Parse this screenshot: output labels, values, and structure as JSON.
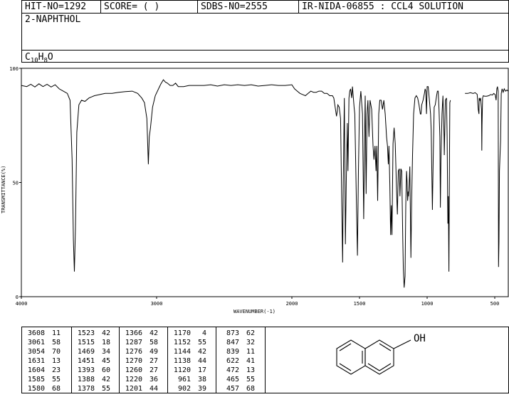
{
  "header": {
    "hit": "HIT-NO=1292",
    "score": "SCORE=  (  )",
    "sdbs": "SDBS-NO=2555",
    "ir": "IR-NIDA-06855 : CCL4 SOLUTION",
    "name": "2-NAPHTHOL",
    "formula_c": "C",
    "formula_c_sub": "10",
    "formula_h": "H",
    "formula_h_sub": "8",
    "formula_o": "O"
  },
  "chart_data": {
    "type": "line",
    "xlabel": "WAVENUMBER(-1)",
    "ylabel": "TRANSMITTANCE(%)",
    "xlim": [
      4000,
      400
    ],
    "ylim": [
      0,
      100
    ],
    "xticks": [
      4000,
      3000,
      2000,
      1500,
      1000,
      500
    ],
    "xtick_labels": [
      "4000",
      "3000",
      "2000",
      "1500",
      "1000",
      "500"
    ],
    "yticks": [
      0,
      50,
      100
    ],
    "ytick_labels": [
      "0",
      "50",
      "100"
    ],
    "grid": false,
    "series": [
      {
        "segments": [
          [
            [
              4000,
              92.5
            ],
            [
              3960,
              92
            ],
            [
              3930,
              93
            ],
            [
              3900,
              91.8
            ],
            [
              3870,
              93.2
            ],
            [
              3840,
              92
            ],
            [
              3810,
              93
            ],
            [
              3780,
              91.8
            ],
            [
              3750,
              92.8
            ],
            [
              3720,
              91
            ],
            [
              3690,
              90
            ],
            [
              3660,
              89
            ],
            [
              3640,
              86
            ],
            [
              3625,
              60
            ],
            [
              3615,
              25
            ],
            [
              3608,
              11
            ],
            [
              3600,
              30
            ],
            [
              3590,
              72
            ],
            [
              3575,
              84
            ],
            [
              3555,
              86
            ],
            [
              3530,
              85.5
            ],
            [
              3500,
              87
            ],
            [
              3460,
              88
            ],
            [
              3420,
              88.5
            ],
            [
              3380,
              89
            ],
            [
              3330,
              89
            ],
            [
              3280,
              89.5
            ],
            [
              3230,
              89.8
            ],
            [
              3180,
              90
            ],
            [
              3140,
              89
            ],
            [
              3110,
              87
            ],
            [
              3090,
              85
            ],
            [
              3072,
              78
            ],
            [
              3061,
              58
            ],
            [
              3054,
              70
            ],
            [
              3045,
              74
            ],
            [
              3030,
              83
            ],
            [
              3010,
              88
            ],
            [
              2990,
              90.5
            ],
            [
              2970,
              93
            ],
            [
              2950,
              95
            ],
            [
              2935,
              94
            ],
            [
              2920,
              93.5
            ],
            [
              2900,
              92.5
            ],
            [
              2880,
              92.5
            ],
            [
              2860,
              93.5
            ],
            [
              2840,
              92
            ],
            [
              2800,
              92
            ],
            [
              2760,
              92.5
            ],
            [
              2700,
              92.5
            ],
            [
              2650,
              92.5
            ],
            [
              2600,
              92.8
            ],
            [
              2550,
              92.2
            ],
            [
              2500,
              92.8
            ],
            [
              2450,
              92.5
            ],
            [
              2400,
              92.8
            ],
            [
              2350,
              92.5
            ],
            [
              2300,
              92.8
            ],
            [
              2250,
              92.2
            ],
            [
              2200,
              92.5
            ],
            [
              2150,
              92.8
            ],
            [
              2100,
              92.5
            ],
            [
              2050,
              92.5
            ],
            [
              2000,
              92.8
            ],
            [
              1980,
              91
            ],
            [
              1960,
              90
            ],
            [
              1940,
              89
            ],
            [
              1920,
              88.5
            ],
            [
              1900,
              88
            ],
            [
              1880,
              89
            ],
            [
              1860,
              90
            ],
            [
              1840,
              89.5
            ],
            [
              1820,
              89.5
            ],
            [
              1800,
              90
            ],
            [
              1780,
              90
            ],
            [
              1760,
              89
            ],
            [
              1740,
              89
            ],
            [
              1720,
              88
            ],
            [
              1700,
              88
            ],
            [
              1690,
              87
            ],
            [
              1680,
              83
            ],
            [
              1670,
              79
            ],
            [
              1665,
              81
            ],
            [
              1660,
              84
            ],
            [
              1650,
              83
            ],
            [
              1640,
              78
            ],
            [
              1631,
              40
            ],
            [
              1625,
              15
            ],
            [
              1620,
              50
            ],
            [
              1612,
              87
            ],
            [
              1604,
              23
            ],
            [
              1598,
              50
            ],
            [
              1590,
              76
            ],
            [
              1585,
              55
            ],
            [
              1578,
              87
            ],
            [
              1572,
              90
            ],
            [
              1566,
              91
            ],
            [
              1558,
              87
            ],
            [
              1552,
              92
            ],
            [
              1545,
              87
            ],
            [
              1540,
              83
            ],
            [
              1535,
              80
            ],
            [
              1523,
              42
            ],
            [
              1515,
              18
            ],
            [
              1508,
              55
            ],
            [
              1500,
              83
            ],
            [
              1490,
              90
            ],
            [
              1478,
              80
            ],
            [
              1469,
              34
            ],
            [
              1462,
              70
            ],
            [
              1458,
              88
            ],
            [
              1451,
              45
            ],
            [
              1444,
              80
            ],
            [
              1438,
              86
            ],
            [
              1430,
              70
            ],
            [
              1422,
              86
            ],
            [
              1410,
              82
            ],
            [
              1400,
              66
            ],
            [
              1393,
              60
            ],
            [
              1385,
              66
            ],
            [
              1378,
              55
            ],
            [
              1372,
              66
            ],
            [
              1366,
              42
            ],
            [
              1358,
              80
            ],
            [
              1350,
              86
            ],
            [
              1340,
              86
            ],
            [
              1330,
              82
            ],
            [
              1320,
              86
            ],
            [
              1310,
              80
            ],
            [
              1300,
              70
            ],
            [
              1293,
              66
            ],
            [
              1287,
              58
            ],
            [
              1282,
              66
            ],
            [
              1276,
              49
            ],
            [
              1270,
              27
            ],
            [
              1264,
              40
            ],
            [
              1260,
              27
            ],
            [
              1252,
              67
            ],
            [
              1244,
              74
            ],
            [
              1236,
              67
            ],
            [
              1226,
              46
            ],
            [
              1220,
              36
            ],
            [
              1213,
              55
            ],
            [
              1206,
              56
            ],
            [
              1201,
              44
            ],
            [
              1194,
              56
            ],
            [
              1188,
              55
            ],
            [
              1180,
              25
            ],
            [
              1176,
              12
            ],
            [
              1170,
              4
            ],
            [
              1163,
              9
            ],
            [
              1158,
              40
            ],
            [
              1152,
              55
            ],
            [
              1148,
              50
            ],
            [
              1144,
              42
            ],
            [
              1140,
              46
            ],
            [
              1138,
              44
            ],
            [
              1133,
              49
            ],
            [
              1128,
              57
            ],
            [
              1120,
              17
            ],
            [
              1114,
              43
            ],
            [
              1108,
              62
            ],
            [
              1100,
              80
            ],
            [
              1090,
              87
            ],
            [
              1080,
              88
            ],
            [
              1070,
              87
            ],
            [
              1060,
              84
            ],
            [
              1050,
              80
            ],
            [
              1045,
              80
            ],
            [
              1040,
              84
            ],
            [
              1030,
              86
            ],
            [
              1020,
              89
            ],
            [
              1015,
              91
            ],
            [
              1010,
              90
            ],
            [
              1005,
              80
            ],
            [
              1000,
              92
            ],
            [
              992,
              92
            ],
            [
              985,
              87
            ],
            [
              975,
              80
            ],
            [
              970,
              73
            ],
            [
              961,
              38
            ],
            [
              955,
              60
            ],
            [
              948,
              83
            ],
            [
              940,
              84
            ],
            [
              930,
              88
            ],
            [
              924,
              90
            ],
            [
              918,
              90
            ],
            [
              912,
              82
            ],
            [
              906,
              70
            ],
            [
              902,
              39
            ],
            [
              898,
              60
            ],
            [
              890,
              80
            ],
            [
              883,
              88
            ],
            [
              875,
              70
            ],
            [
              873,
              62
            ],
            [
              869,
              74
            ],
            [
              865,
              86
            ],
            [
              857,
              87
            ],
            [
              852,
              70
            ],
            [
              847,
              32
            ],
            [
              843,
              44
            ],
            [
              839,
              11
            ],
            [
              835,
              60
            ],
            [
              832,
              85
            ],
            [
              828,
              86
            ]
          ],
          [
            [
              720,
              89
            ],
            [
              700,
              89
            ],
            [
              680,
              89.3
            ],
            [
              660,
              89
            ],
            [
              645,
              89.3
            ],
            [
              630,
              88.6
            ],
            [
              622,
              82
            ],
            [
              617,
              80
            ],
            [
              615,
              87
            ],
            [
              610,
              86
            ],
            [
              605,
              87
            ],
            [
              598,
              82
            ],
            [
              596,
              64
            ],
            [
              594,
              75
            ],
            [
              590,
              87
            ],
            [
              585,
              88
            ],
            [
              575,
              87.8
            ],
            [
              560,
              87.8
            ],
            [
              545,
              88
            ],
            [
              530,
              88.5
            ],
            [
              517,
              88.3
            ],
            [
              508,
              89
            ],
            [
              497,
              88.5
            ],
            [
              490,
              86
            ],
            [
              485,
              91
            ],
            [
              480,
              92
            ],
            [
              475,
              90
            ],
            [
              472,
              13
            ],
            [
              469,
              24
            ],
            [
              465,
              55
            ],
            [
              461,
              62
            ],
            [
              457,
              68
            ],
            [
              452,
              89
            ],
            [
              446,
              91
            ],
            [
              438,
              89.5
            ],
            [
              430,
              91
            ],
            [
              420,
              90
            ],
            [
              410,
              90.5
            ],
            [
              400,
              90
            ]
          ]
        ]
      }
    ]
  },
  "peaks": [
    [
      [
        "3608",
        "11"
      ],
      [
        "3061",
        "58"
      ],
      [
        "3054",
        "70"
      ],
      [
        "1631",
        "13"
      ],
      [
        "1604",
        "23"
      ],
      [
        "1585",
        "55"
      ],
      [
        "1580",
        "68"
      ]
    ],
    [
      [
        "1523",
        "42"
      ],
      [
        "1515",
        "18"
      ],
      [
        "1469",
        "34"
      ],
      [
        "1451",
        "45"
      ],
      [
        "1393",
        "60"
      ],
      [
        "1388",
        "42"
      ],
      [
        "1378",
        "55"
      ]
    ],
    [
      [
        "1366",
        "42"
      ],
      [
        "1287",
        "58"
      ],
      [
        "1276",
        "49"
      ],
      [
        "1270",
        "27"
      ],
      [
        "1260",
        "27"
      ],
      [
        "1220",
        "36"
      ],
      [
        "1201",
        "44"
      ]
    ],
    [
      [
        "1170",
        "4"
      ],
      [
        "1152",
        "55"
      ],
      [
        "1144",
        "42"
      ],
      [
        "1138",
        "44"
      ],
      [
        "1120",
        "17"
      ],
      [
        "961",
        "38"
      ],
      [
        "902",
        "39"
      ]
    ],
    [
      [
        "873",
        "62"
      ],
      [
        "847",
        "32"
      ],
      [
        "839",
        "11"
      ],
      [
        "622",
        "41"
      ],
      [
        "472",
        "13"
      ],
      [
        "465",
        "55"
      ],
      [
        "457",
        "68"
      ]
    ]
  ],
  "structure": {
    "label": "OH"
  }
}
